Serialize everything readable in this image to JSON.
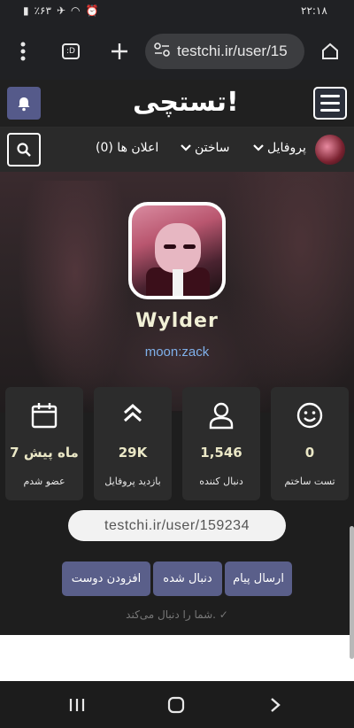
{
  "status_bar": {
    "time": "۲۲:۱۸",
    "battery": "٪۶۳"
  },
  "browser": {
    "url": "testchi.ir/user/15",
    "tab_count_label": ":D"
  },
  "header": {
    "logo": "تستچی!"
  },
  "nav": {
    "profile": "پروفایل",
    "build": "ساختن",
    "notifications": "اعلان ها (0)"
  },
  "profile": {
    "username": "Wylder",
    "handle": "moon:zack"
  },
  "stats": [
    {
      "value": "0",
      "label": "تست ساختم",
      "icon": "smiley-icon"
    },
    {
      "value": "1,546",
      "label": "دنبال کننده",
      "icon": "person-icon"
    },
    {
      "value": "29K",
      "label": "بازدید پروفایل",
      "icon": "double-chevron-up-icon"
    },
    {
      "value": "7 ماه پیش",
      "label": "عضو شدم",
      "icon": "calendar-icon"
    }
  ],
  "profile_link": "testchi.ir/user/159234",
  "actions": {
    "send_message": "ارسال پیام",
    "followed": "دنبال شده",
    "add_friend": "افزودن دوست"
  },
  "follow_note": "شما را دنبال می‌کند.",
  "colors": {
    "accent": "#5a5f8a",
    "username": "#f1f0d6",
    "handle": "#7fb0ea",
    "background": "#1e1e1e"
  }
}
